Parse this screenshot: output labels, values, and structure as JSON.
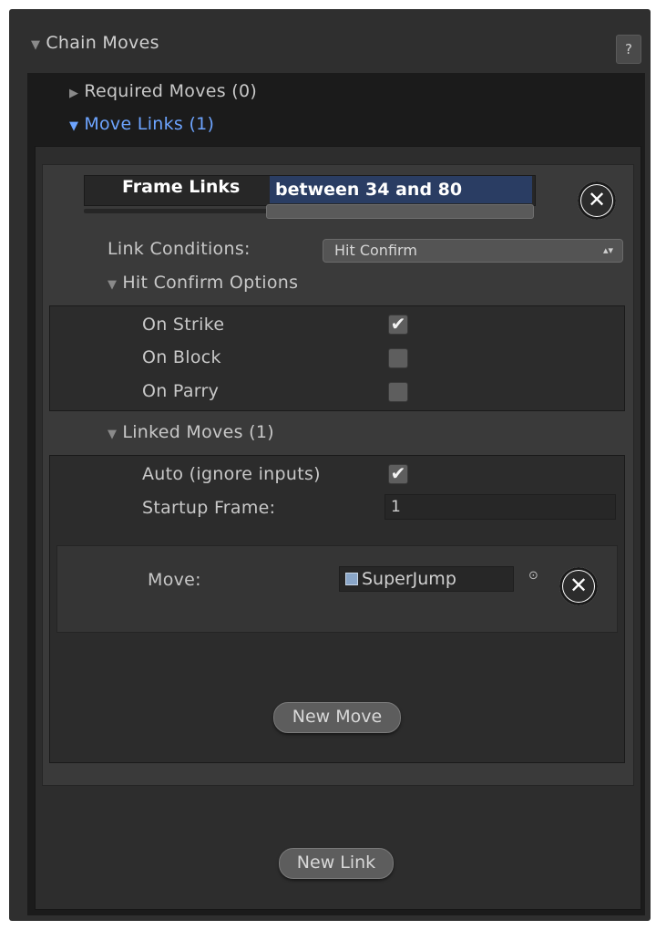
{
  "header": {
    "title": "Chain Moves",
    "help_label": "?"
  },
  "sections": {
    "required_moves": "Required Moves (0)",
    "move_links": "Move Links (1)"
  },
  "frame_links": {
    "label": "Frame Links",
    "range_text": "between 34 and 80",
    "min": 34,
    "max": 80
  },
  "link_conditions": {
    "label": "Link Conditions:",
    "selected": "Hit Confirm"
  },
  "hit_confirm": {
    "title": "Hit Confirm Options",
    "options": [
      {
        "label": "On Strike",
        "checked": true
      },
      {
        "label": "On Block",
        "checked": false
      },
      {
        "label": "On Parry",
        "checked": false
      }
    ]
  },
  "linked_moves": {
    "title": "Linked Moves (1)",
    "auto_label": "Auto (ignore inputs)",
    "auto_checked": true,
    "startup_label": "Startup Frame:",
    "startup_value": "1",
    "move_label": "Move:",
    "move_value": "SuperJump",
    "new_move_label": "New Move"
  },
  "new_link_label": "New Link",
  "icons": {
    "close": "close-icon",
    "check": "✔"
  },
  "colors": {
    "background": "#2f2f2f",
    "highlight": "#6da4ff",
    "selection": "#2a3d63"
  }
}
